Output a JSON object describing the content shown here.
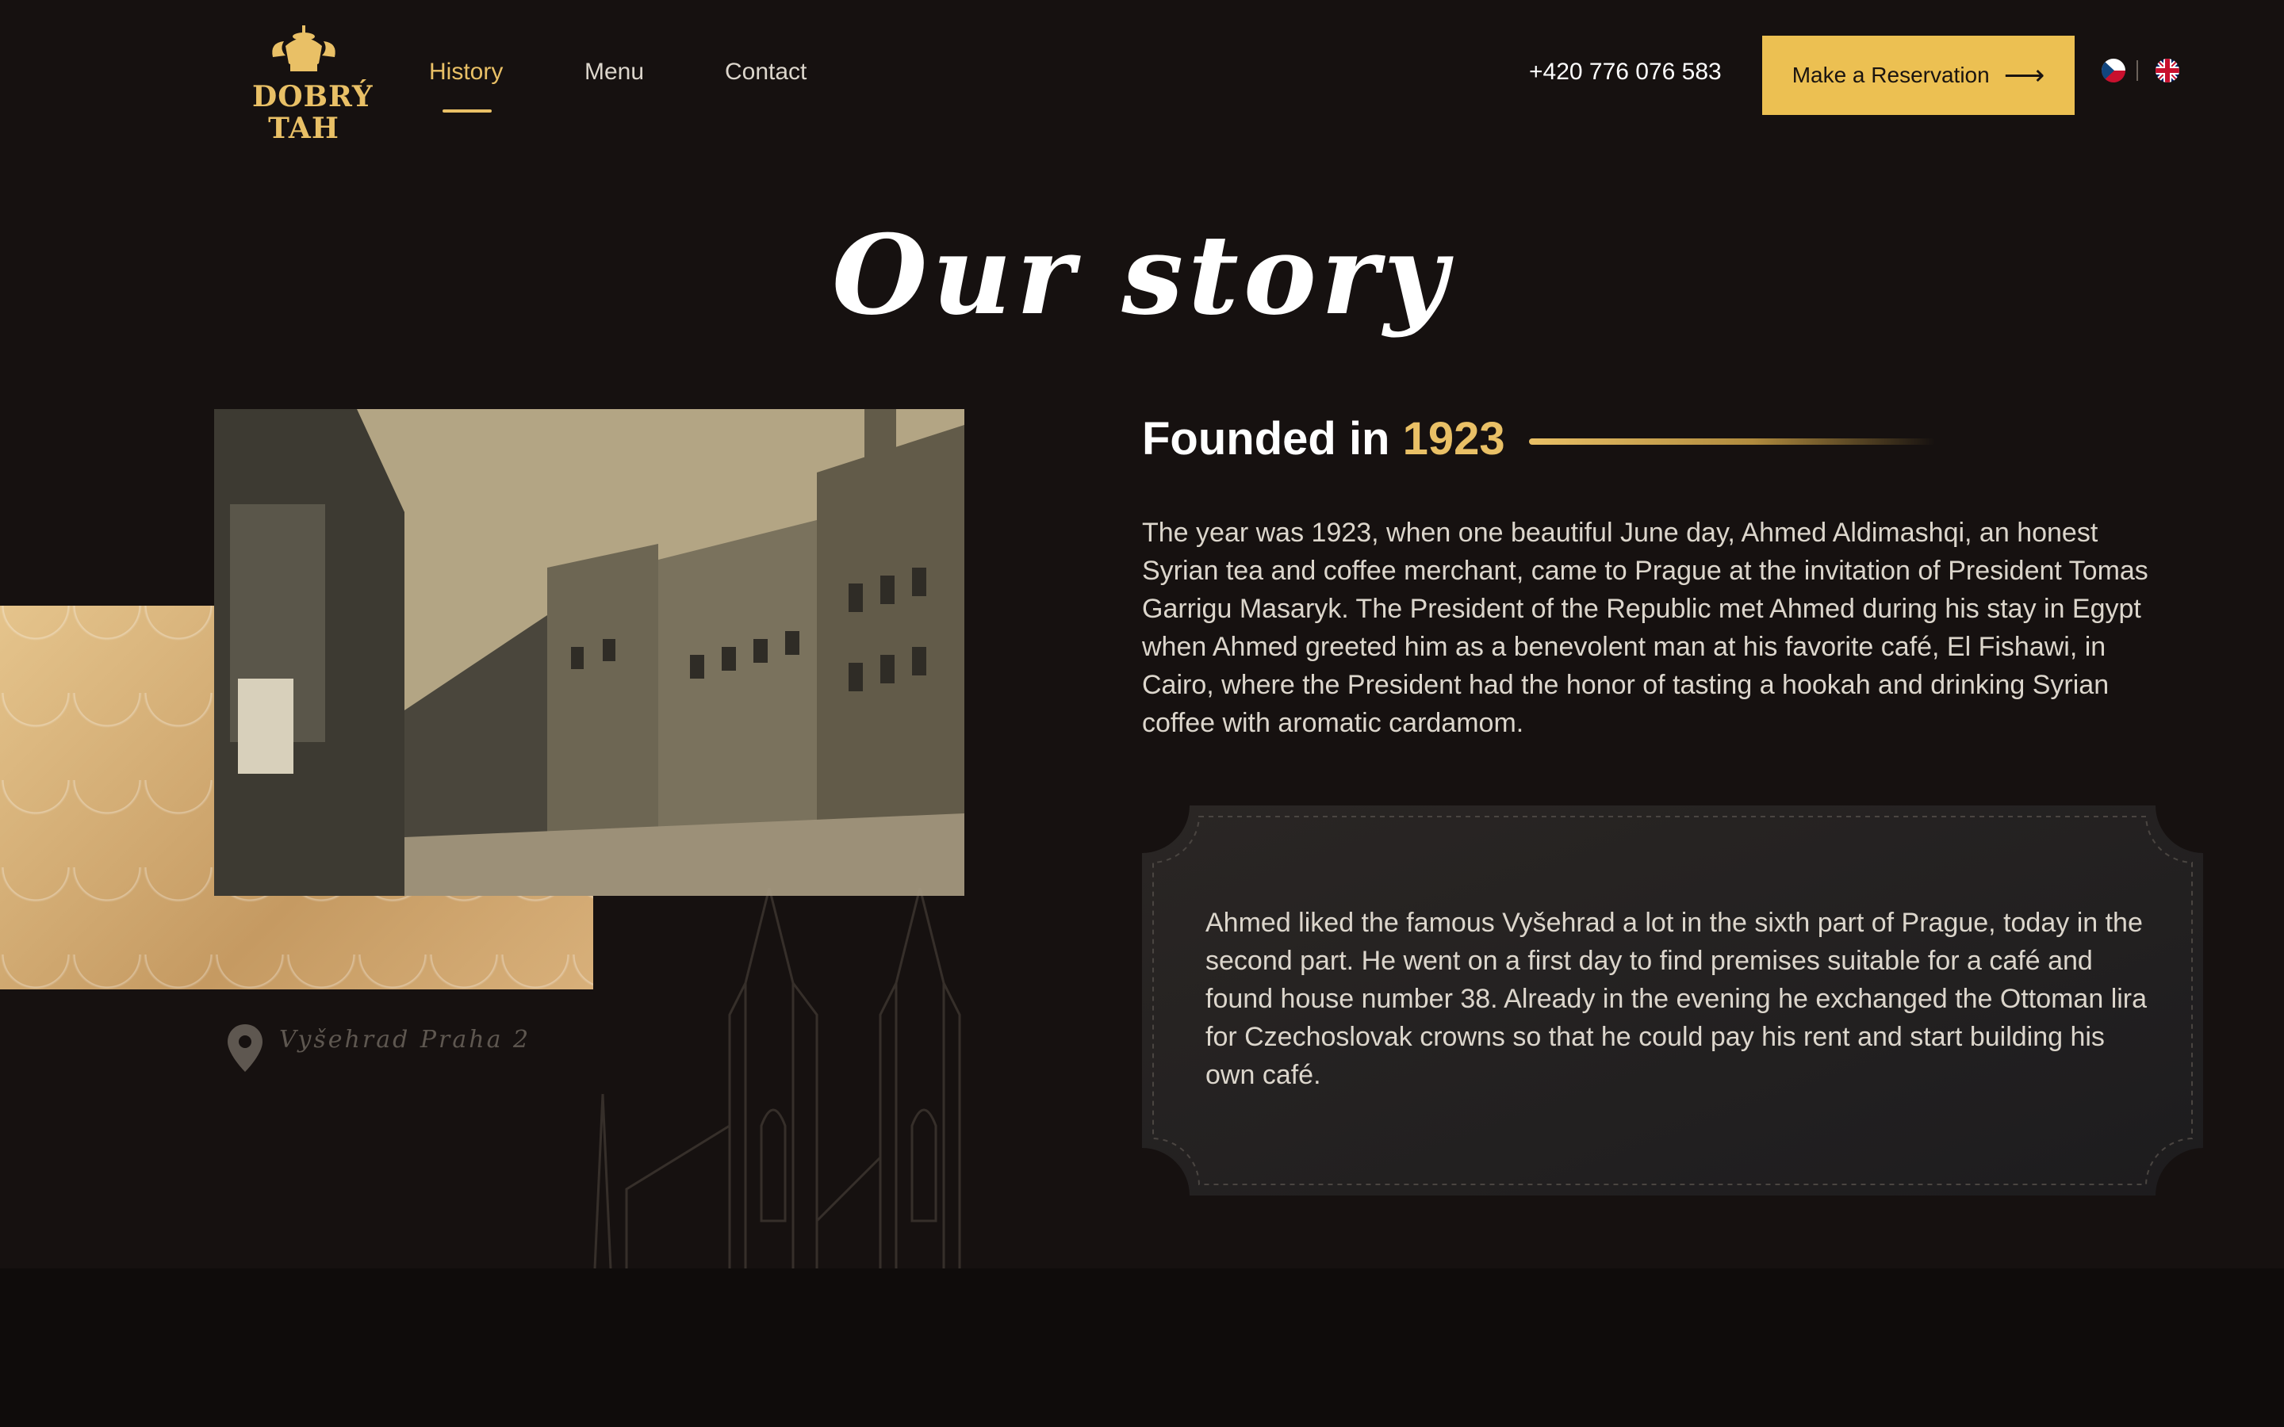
{
  "brand": {
    "logo_line1": "DOBRÝ",
    "logo_line2": "TAH",
    "accent": "#ECC052"
  },
  "nav": {
    "items": [
      {
        "label": "History",
        "active": true
      },
      {
        "label": "Menu",
        "active": false
      },
      {
        "label": "Contact",
        "active": false
      }
    ],
    "phone": "+420 776 076 583",
    "cta_label": "Make a Reservation",
    "languages": [
      "cz-flag-icon",
      "uk-flag-icon"
    ]
  },
  "hero": {
    "title": "Our story"
  },
  "founded": {
    "prefix": "Founded in",
    "year": "1923"
  },
  "story": {
    "paragraph1": "The year was 1923, when one beautiful June day, Ahmed Aldimashqi, an honest Syrian tea and coffee merchant, came to Prague at the invitation of President Tomas Garrigu Masaryk. The President of the Republic met Ahmed during his stay in Egypt when Ahmed greeted him as a benevolent man at his favorite café, El Fishawi, in Cairo, where the President had the honor of tasting a hookah and drinking Syrian coffee with aromatic cardamom.",
    "paragraph2": "Ahmed liked the famous Vyšehrad a lot in the sixth part of Prague, today in the second part. He went on a first day to find premises suitable for a café and found house number 38. Already in the evening he exchanged the Ottoman lira for Czechoslovak crowns so that he could pay his rent and start building his own café."
  },
  "location": {
    "label": "Vyšehrad Praha 2"
  }
}
